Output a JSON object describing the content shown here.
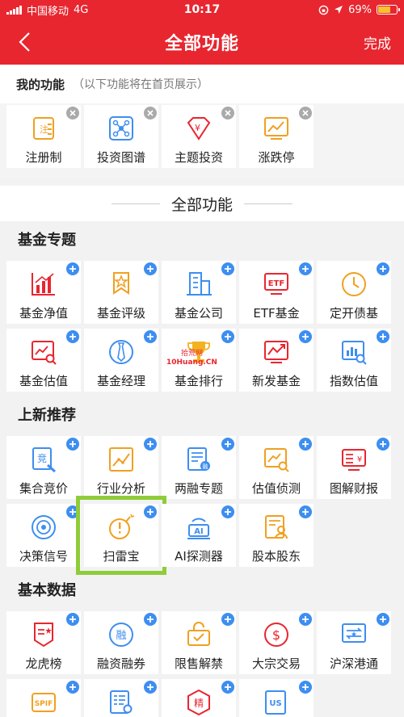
{
  "status": {
    "carrier": "中国移动",
    "network": "4G",
    "time": "10:17",
    "battery": "69%"
  },
  "nav": {
    "title": "全部功能",
    "done": "完成"
  },
  "my": {
    "title": "我的功能",
    "subtitle": "（以下功能将在首页展示）",
    "items": [
      {
        "label": "注册制",
        "icon": "registration-icon"
      },
      {
        "label": "投资图谱",
        "icon": "network-graph-icon"
      },
      {
        "label": "主题投资",
        "icon": "gem-icon"
      },
      {
        "label": "涨跌停",
        "icon": "trend-chart-icon"
      }
    ]
  },
  "all_title": "全部功能",
  "sections": [
    {
      "title": "基金专题",
      "items": [
        {
          "label": "基金净值",
          "icon": "bar-chart-icon"
        },
        {
          "label": "基金评级",
          "icon": "rating-badge-icon"
        },
        {
          "label": "基金公司",
          "icon": "building-icon"
        },
        {
          "label": "ETF基金",
          "icon": "etf-icon",
          "text": "ETF"
        },
        {
          "label": "定开债基",
          "icon": "clock-icon"
        },
        {
          "label": "基金估值",
          "icon": "valuation-search-icon"
        },
        {
          "label": "基金经理",
          "icon": "manager-tie-icon"
        },
        {
          "label": "基金排行",
          "icon": "trophy-icon"
        },
        {
          "label": "新发基金",
          "icon": "new-fund-icon"
        },
        {
          "label": "指数估值",
          "icon": "index-chart-icon"
        }
      ]
    },
    {
      "title": "上新推荐",
      "items": [
        {
          "label": "集合竞价",
          "icon": "auction-icon",
          "text": "竞"
        },
        {
          "label": "行业分析",
          "icon": "industry-chart-icon"
        },
        {
          "label": "两融专题",
          "icon": "margin-doc-icon"
        },
        {
          "label": "估值侦测",
          "icon": "detect-chart-icon"
        },
        {
          "label": "图解财报",
          "icon": "report-icon"
        },
        {
          "label": "决策信号",
          "icon": "signal-icon"
        },
        {
          "label": "扫雷宝",
          "icon": "bomb-icon"
        },
        {
          "label": "AI探测器",
          "icon": "ai-detector-icon",
          "text": "AI"
        },
        {
          "label": "股本股东",
          "icon": "shareholder-icon"
        }
      ]
    },
    {
      "title": "基本数据",
      "items": [
        {
          "label": "龙虎榜",
          "icon": "dragon-list-icon"
        },
        {
          "label": "融资融券",
          "icon": "financing-icon",
          "text": "融"
        },
        {
          "label": "限售解禁",
          "icon": "unlock-icon"
        },
        {
          "label": "大宗交易",
          "icon": "dollar-icon"
        },
        {
          "label": "沪深港通",
          "icon": "hk-connect-icon"
        },
        {
          "label": "",
          "icon": "spif-icon",
          "text": "SPIF"
        },
        {
          "label": "",
          "icon": "list-doc-icon"
        },
        {
          "label": "",
          "icon": "fine-icon",
          "text": "精"
        },
        {
          "label": "",
          "icon": "us-stock-icon",
          "text": "US"
        }
      ]
    }
  ],
  "watermark": {
    "text1": "拾荒网",
    "text2": "10Huang.CN"
  },
  "colors": {
    "red": "#e8262f",
    "orange": "#f0a020",
    "blue": "#3d8ef0",
    "highlight": "#8fcc3a"
  }
}
